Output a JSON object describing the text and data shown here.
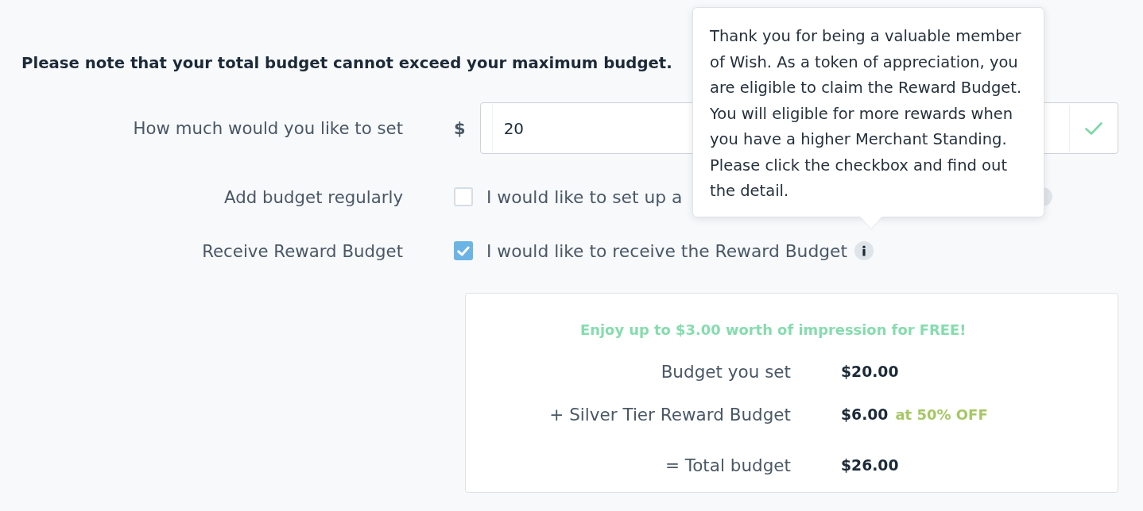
{
  "notice": "Please note that your total budget cannot exceed your maximum budget.",
  "form": {
    "rows": [
      {
        "kind": "amount",
        "label": "How much would you like to set",
        "currency": "$",
        "value": "20",
        "valid": true
      },
      {
        "kind": "checkbox",
        "label": "Add budget regularly",
        "option": "I would like to set up a",
        "checked": false,
        "info": true,
        "info_covered": true
      },
      {
        "kind": "checkbox",
        "label": "Receive Reward Budget",
        "option": "I would like to receive the Reward Budget",
        "checked": true,
        "info": true,
        "info_covered": false
      }
    ]
  },
  "tooltip": {
    "text": "Thank you for being a valuable member of Wish. As a token of appreciation, you are eligible to claim the Reward Budget. You will eligible for more rewards when you have a higher Merchant Standing. Please click the checkbox and find out the detail."
  },
  "summary": {
    "headline": "Enjoy up to $3.00 worth of impression for FREE!",
    "lines": [
      {
        "kind": "item",
        "label": "Budget you set",
        "amount": "$20.00"
      },
      {
        "kind": "item",
        "label": "+ Silver Tier Reward Budget",
        "amount": "$6.00",
        "note": "at 50% OFF"
      },
      {
        "kind": "total",
        "label": "= Total budget",
        "amount": "$26.00"
      }
    ]
  }
}
